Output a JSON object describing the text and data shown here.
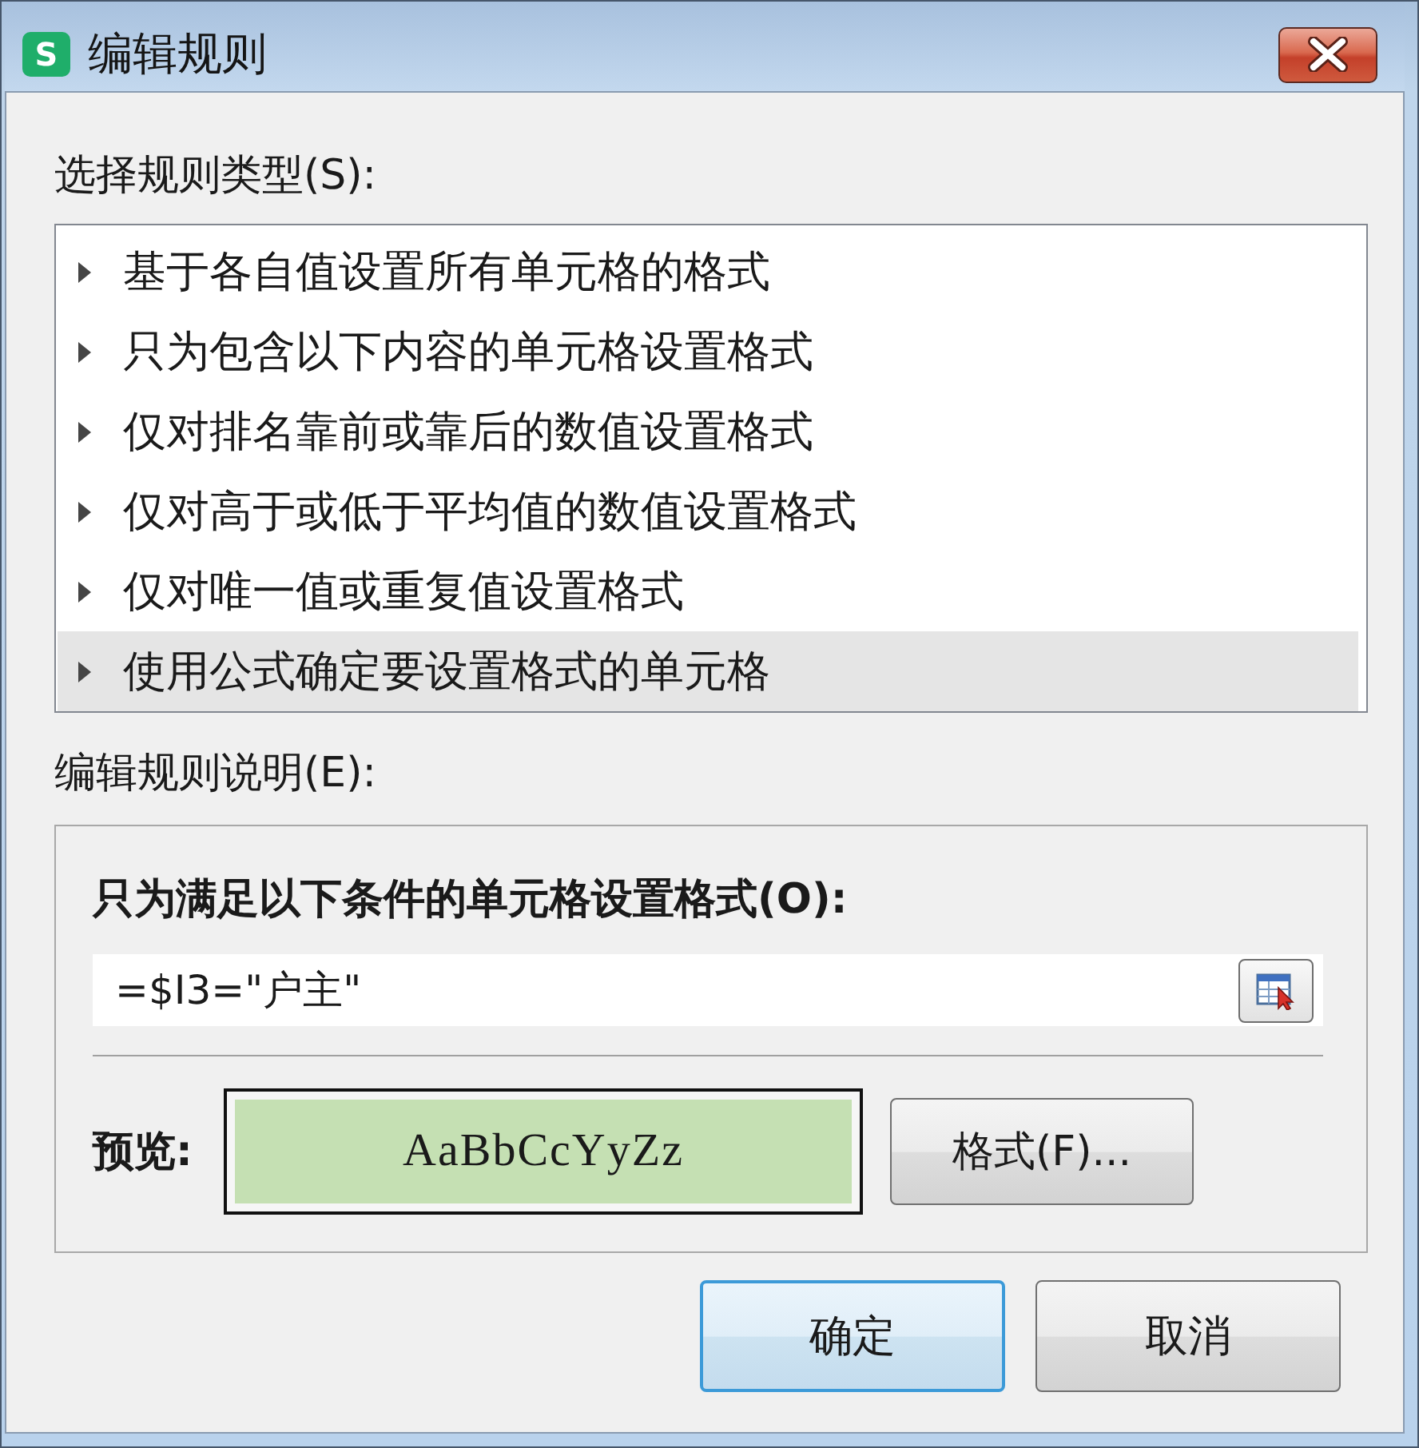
{
  "window": {
    "title": "编辑规则",
    "logo_letter": "S"
  },
  "rule_type": {
    "label": "选择规则类型(S):",
    "items": [
      {
        "label": "基于各自值设置所有单元格的格式",
        "selected": false
      },
      {
        "label": "只为包含以下内容的单元格设置格式",
        "selected": false
      },
      {
        "label": "仅对排名靠前或靠后的数值设置格式",
        "selected": false
      },
      {
        "label": "仅对高于或低于平均值的数值设置格式",
        "selected": false
      },
      {
        "label": "仅对唯一值或重复值设置格式",
        "selected": false
      },
      {
        "label": "使用公式确定要设置格式的单元格",
        "selected": true
      }
    ]
  },
  "rule_description": {
    "label": "编辑规则说明(E):",
    "condition_label": "只为满足以下条件的单元格设置格式(O):",
    "formula": {
      "value": "=$I3=\"户主\""
    },
    "preview_label": "预览:",
    "preview_sample": "AaBbCcYyZz",
    "format_button": "格式(F)..."
  },
  "buttons": [
    {
      "label": "确定",
      "default": true
    },
    {
      "label": "取消",
      "default": false
    }
  ]
}
